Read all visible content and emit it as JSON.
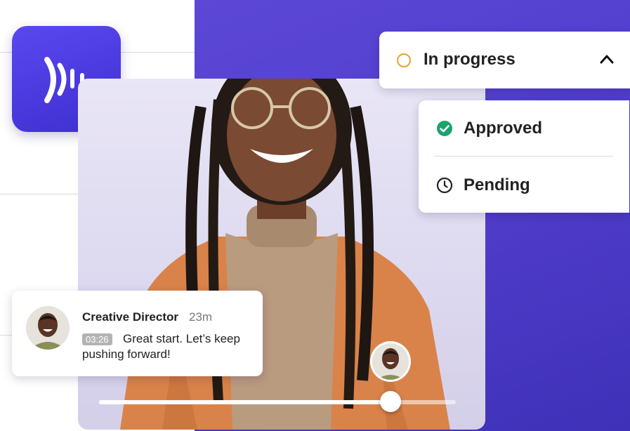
{
  "status": {
    "current_label": "In progress",
    "current_icon": "pending-circle-icon",
    "ring_color": "#e8a23a",
    "expanded": true
  },
  "status_options": [
    {
      "label": "Approved",
      "icon": "check-circle-icon",
      "color": "#1aa36b"
    },
    {
      "label": "Pending",
      "icon": "clock-icon",
      "color": "#222222"
    }
  ],
  "comment": {
    "author": "Creative Director",
    "age": "23m",
    "timecode": "03:26",
    "text": "Great start. Let’s keep pushing forward!"
  },
  "playback": {
    "progress": 0.82
  },
  "colors": {
    "brand_purple": "#4f3cc9",
    "app_icon": "#4a3be6"
  }
}
